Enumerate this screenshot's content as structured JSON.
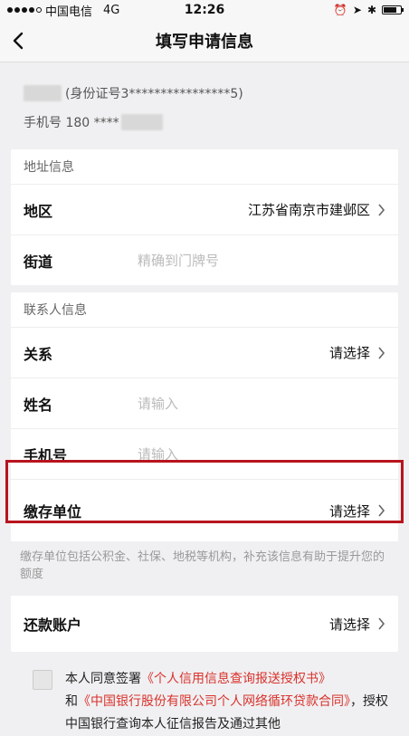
{
  "status_bar": {
    "carrier": "中国电信",
    "network": "4G",
    "time": "12:26"
  },
  "nav": {
    "title": "填写申请信息"
  },
  "user": {
    "id_text": "(身份证号3****************5)",
    "phone_prefix": "手机号 180 ****"
  },
  "address_section": {
    "header": "地址信息",
    "region_label": "地区",
    "region_value": "江苏省南京市建邺区",
    "street_label": "街道",
    "street_placeholder": "精确到门牌号"
  },
  "contact_section": {
    "header": "联系人信息",
    "relation_label": "关系",
    "relation_value": "请选择",
    "name_label": "姓名",
    "name_placeholder": "请输入",
    "phone_label": "手机号",
    "phone_placeholder": "请输入",
    "employer_label": "缴存单位",
    "employer_value": "请选择"
  },
  "hint_text": "缴存单位包括公积金、社保、地税等机构，补充该信息有助于提升您的额度",
  "repay": {
    "label": "还款账户",
    "value": "请选择"
  },
  "agreement": {
    "prefix": "本人同意签署",
    "link1": "《个人信用信息查询报送授权书》",
    "and": "和",
    "link2": "《中国银行股份有限公司个人网络循环贷款合同》",
    "suffix": "，授权中国银行查询本人征信报告及通过其他"
  },
  "colors": {
    "highlight": "#b8141e",
    "link": "#d9322c"
  }
}
